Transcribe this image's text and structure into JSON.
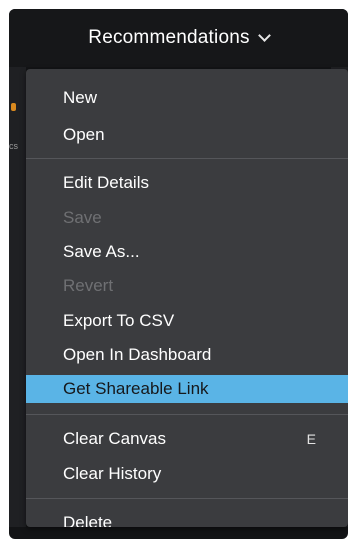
{
  "header": {
    "title": "Recommendations"
  },
  "background": {
    "left_peek_text": "cs"
  },
  "menu": {
    "items": [
      {
        "label": "New"
      },
      {
        "label": "Open"
      },
      {
        "label": "Edit Details"
      },
      {
        "label": "Save",
        "disabled": true
      },
      {
        "label": "Save As..."
      },
      {
        "label": "Revert",
        "disabled": true
      },
      {
        "label": "Export To CSV"
      },
      {
        "label": "Open In Dashboard"
      },
      {
        "label": "Get Shareable Link",
        "highlighted": true
      },
      {
        "label": "Clear Canvas",
        "shortcut": "E"
      },
      {
        "label": "Clear History"
      },
      {
        "label": "Delete"
      }
    ]
  },
  "colors": {
    "highlight": "#5ab4e6",
    "menu_background": "#3b3c3f",
    "disabled_text": "#6f7073",
    "accent_orange": "#d9891f"
  },
  "icons": {
    "dropdown": "chevron-down-icon"
  }
}
